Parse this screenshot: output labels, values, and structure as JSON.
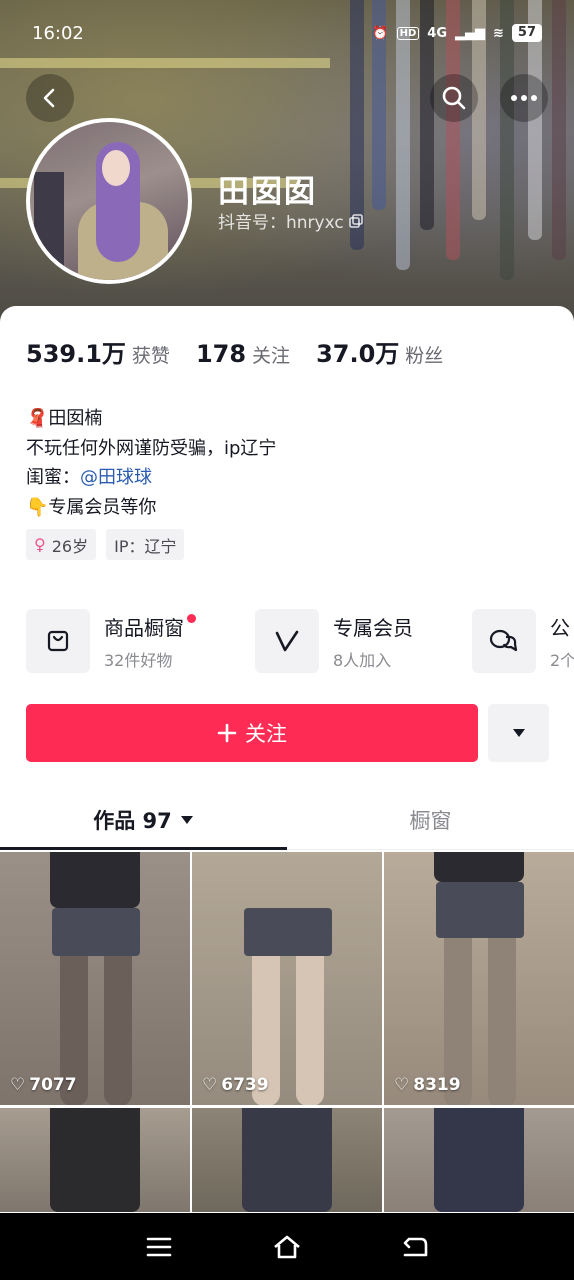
{
  "status_bar": {
    "time": "16:02",
    "network": "4G",
    "battery": "57"
  },
  "profile": {
    "name": "田囡囡",
    "douyin_id": "抖音号：hnryxc"
  },
  "stats": [
    {
      "value": "539.1万",
      "label": "获赞"
    },
    {
      "value": "178",
      "label": "关注"
    },
    {
      "value": "37.0万",
      "label": "粉丝"
    }
  ],
  "bio": {
    "line1": "田囡楠",
    "line2": "不玩任何外网谨防受骗，ip辽宁",
    "line3_prefix": "闺蜜：",
    "line3_mention": "@田球球",
    "line4": "专属会员等你"
  },
  "tags": {
    "age": "26岁",
    "ip": "IP：辽宁"
  },
  "shortcuts": [
    {
      "title": "商品橱窗",
      "sub": "32件好物",
      "icon": "shopping-bag-icon"
    },
    {
      "title": "专属会员",
      "sub": "8人加入",
      "icon": "member-v-icon"
    },
    {
      "title": "公",
      "sub": "2个",
      "icon": "group-chat-icon"
    }
  ],
  "actions": {
    "follow": "关注"
  },
  "tabs": {
    "works": "作品 97",
    "showcase": "橱窗"
  },
  "videos": [
    {
      "likes": "7077"
    },
    {
      "likes": "6739"
    },
    {
      "likes": "8319"
    },
    {
      "likes": ""
    },
    {
      "likes": ""
    },
    {
      "likes": ""
    }
  ],
  "colors": {
    "accent": "#fe2c55",
    "mention": "#2a5db0"
  }
}
